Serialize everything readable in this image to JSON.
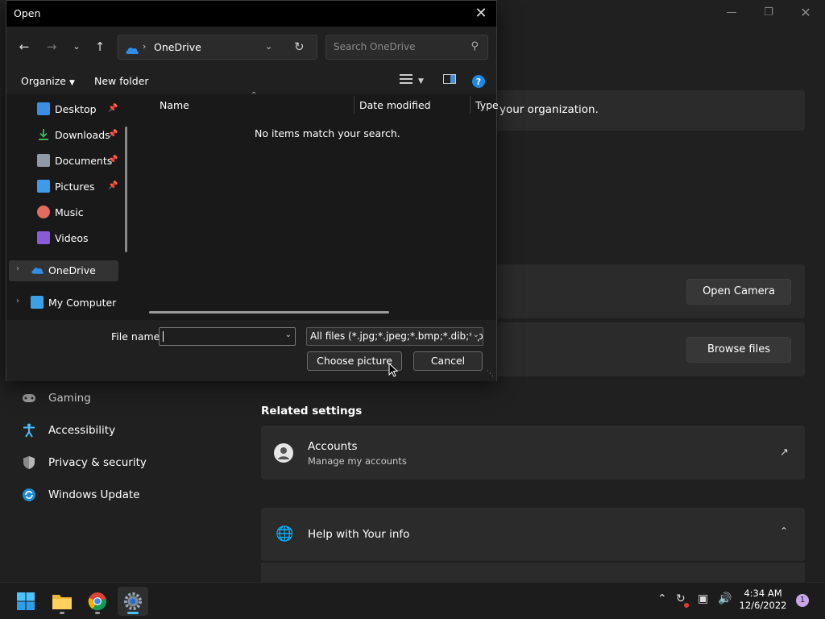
{
  "settings": {
    "org_text": "your organization.",
    "open_camera": "Open Camera",
    "browse_files": "Browse files",
    "related_settings": "Related settings",
    "nav": [
      {
        "label": "Gaming"
      },
      {
        "label": "Accessibility"
      },
      {
        "label": "Privacy & security"
      },
      {
        "label": "Windows Update"
      }
    ],
    "accounts_title": "Accounts",
    "accounts_sub": "Manage my accounts",
    "help_title": "Help with Your info"
  },
  "dialog": {
    "title": "Open",
    "address_location": "OneDrive",
    "search_placeholder": "Search OneDrive",
    "organize": "Organize",
    "new_folder": "New folder",
    "nav_pane": [
      {
        "label": "Desktop"
      },
      {
        "label": "Downloads"
      },
      {
        "label": "Documents"
      },
      {
        "label": "Pictures"
      },
      {
        "label": "Music"
      },
      {
        "label": "Videos"
      },
      {
        "label": "OneDrive"
      },
      {
        "label": "My Computer"
      }
    ],
    "columns": {
      "name": "Name",
      "date": "Date modified",
      "type": "Type"
    },
    "empty_message": "No items match your search.",
    "file_name_label": "File name:",
    "file_name_value": "",
    "file_type": "All files (*.jpg;*.jpeg;*.bmp;*.dib;*.png",
    "choose_button": "Choose picture",
    "cancel_button": "Cancel"
  },
  "taskbar": {
    "time": "4:34 AM",
    "date": "12/6/2022",
    "notification_count": "1"
  },
  "colors": {
    "accent": "#4cc2ff",
    "onedrive": "#2f8fe6"
  }
}
